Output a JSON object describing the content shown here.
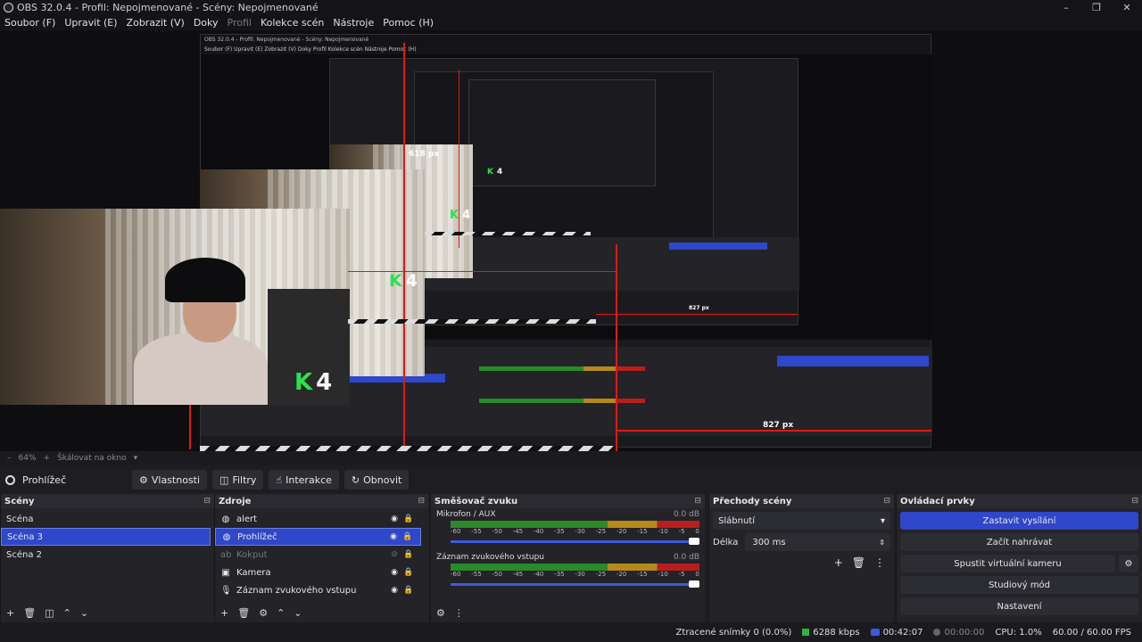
{
  "window": {
    "title": "OBS 32.0.4 - Profil: Nepojmenované - Scény: Nepojmenované",
    "controls": [
      "–",
      "❐",
      "✕"
    ]
  },
  "menu": {
    "items": [
      "Soubor (F)",
      "Upravit (E)",
      "Zobrazit (V)",
      "Doky",
      "Profil",
      "Kolekce scén",
      "Nástroje",
      "Pomoc (H)"
    ]
  },
  "preview": {
    "nested_title": "OBS 32.0.4 - Profil: Nepojmenované - Scény: Nepojmenované",
    "nested_menu": "Soubor (F)   Upravit (E)   Zobrazit (V)   Doky   Profil   Kolekce scén   Nástroje   Pomoc (H)",
    "label_618": "618 px",
    "label_827": "827 px",
    "label_827_small": "827 px",
    "logo_letter": "K",
    "logo_number": "4"
  },
  "zoom": {
    "value": "64%",
    "mode": "Škálovat na okno",
    "minus": "–",
    "plus": "+"
  },
  "source_toolbar": {
    "current_source": "Prohlížeč",
    "properties": "Vlastnosti",
    "filters": "Filtry",
    "interact": "Interakce",
    "refresh": "Obnovit"
  },
  "scenes": {
    "title": "Scény",
    "items": [
      "Scéna",
      "Scéna 3",
      "Scéna 2"
    ],
    "selected": "Scéna 3"
  },
  "sources": {
    "title": "Zdroje",
    "items": [
      {
        "name": "alert",
        "icon": "globe-icon"
      },
      {
        "name": "Prohlížeč",
        "icon": "globe-icon"
      },
      {
        "name": "Kokput",
        "icon": "text-icon"
      },
      {
        "name": "Kamera",
        "icon": "camera-icon"
      },
      {
        "name": "Záznam zvukového vstupu",
        "icon": "microphone-icon"
      }
    ],
    "selected": "Prohlížeč"
  },
  "mixer": {
    "title": "Směšovač zvuku",
    "channels": [
      {
        "name": "Mikrofon / AUX",
        "db": "0.0 dB"
      },
      {
        "name": "Záznam zvukového vstupu",
        "db": "0.0 dB"
      }
    ],
    "ticks": [
      "-60",
      "-55",
      "-50",
      "-45",
      "-40",
      "-35",
      "-30",
      "-25",
      "-20",
      "-15",
      "-10",
      "-5",
      "0"
    ]
  },
  "transitions": {
    "title": "Přechody scény",
    "selected": "Slábnutí",
    "duration_label": "Délka",
    "duration_value": "300 ms"
  },
  "controls": {
    "title": "Ovládací prvky",
    "stop_stream": "Zastavit vysílání",
    "start_record": "Začít nahrávat",
    "virtual_cam": "Spustit virtuální kameru",
    "studio_mode": "Studiový mód",
    "settings": "Nastavení"
  },
  "status": {
    "dropped_frames": "Ztracené snímky 0 (0.0%)",
    "bitrate": "6288 kbps",
    "live_time": "00:42:07",
    "rec_time": "00:00:00",
    "cpu": "CPU: 1.0%",
    "fps": "60.00 / 60.00 FPS"
  },
  "colors": {
    "accent": "#2f47c9",
    "panel": "#232328",
    "background": "#1e1e22",
    "guide_red": "#e01818",
    "logo_green": "#2be24a"
  }
}
